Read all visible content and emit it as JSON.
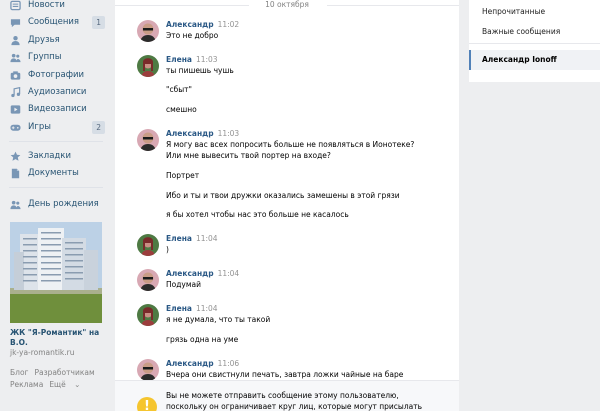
{
  "sidebar": {
    "items": [
      {
        "label": "Новости",
        "icon": "news-icon",
        "badge": ""
      },
      {
        "label": "Сообщения",
        "icon": "message-icon",
        "badge": "1"
      },
      {
        "label": "Друзья",
        "icon": "friends-icon",
        "badge": ""
      },
      {
        "label": "Группы",
        "icon": "groups-icon",
        "badge": ""
      },
      {
        "label": "Фотографии",
        "icon": "camera-icon",
        "badge": ""
      },
      {
        "label": "Аудиозаписи",
        "icon": "music-icon",
        "badge": ""
      },
      {
        "label": "Видеозаписи",
        "icon": "video-icon",
        "badge": ""
      },
      {
        "label": "Игры",
        "icon": "gamepad-icon",
        "badge": "2"
      },
      {
        "label": "Закладки",
        "icon": "star-icon",
        "badge": ""
      },
      {
        "label": "Документы",
        "icon": "document-icon",
        "badge": ""
      },
      {
        "label": "День рождения",
        "icon": "birthday-icon",
        "badge": ""
      }
    ],
    "ad": {
      "title": "ЖК \"Я-Романтик\" на В.О.",
      "url": "jk-ya-romantik.ru"
    },
    "footer": {
      "blog": "Блог",
      "developers": "Разработчикам",
      "ads": "Реклама",
      "more": "Ещё"
    }
  },
  "chat": {
    "date": "10 октября",
    "messages": [
      {
        "author": "Александр",
        "time": "11:02",
        "lines": [
          "Это не добро"
        ]
      },
      {
        "author": "Елена",
        "time": "11:03",
        "lines": [
          "ты пишешь чушь",
          "\"сбыт\"",
          "смешно"
        ]
      },
      {
        "author": "Александр",
        "time": "11:03",
        "lines": [
          "Я могу вас всех попросить больше не появляться в Ионотеке?",
          "Или мне вывесить твой портер на входе?",
          "Портрет",
          "Ибо и ты и твои дружки оказались замешены в этой грязи",
          "я бы хотел чтобы нас это больше не касалось"
        ]
      },
      {
        "author": "Елена",
        "time": "11:04",
        "lines": [
          ")"
        ]
      },
      {
        "author": "Александр",
        "time": "11:04",
        "lines": [
          "Подумай"
        ]
      },
      {
        "author": "Елена",
        "time": "11:04",
        "lines": [
          "я не думала, что ты такой",
          "грязь одна на уме"
        ]
      },
      {
        "author": "Александр",
        "time": "11:06",
        "lines": [
          "Вчера они свистнули печать, завтра ложки чайные на баре"
        ]
      }
    ],
    "warning": {
      "icon": "!",
      "line1": "Вы не можете отправить сообщение этому пользователю,",
      "line2": "поскольку он ограничивает круг лиц, которые могут присылать"
    }
  },
  "filters": {
    "unread": "Непрочитанные",
    "important": "Важные сообщения",
    "active": "Александр Ionoff"
  },
  "colors": {
    "link": "#285473",
    "author": "#2a5885",
    "page_bg": "#edeef0",
    "warning": "#f5c52f",
    "active_border": "#5181b8"
  }
}
